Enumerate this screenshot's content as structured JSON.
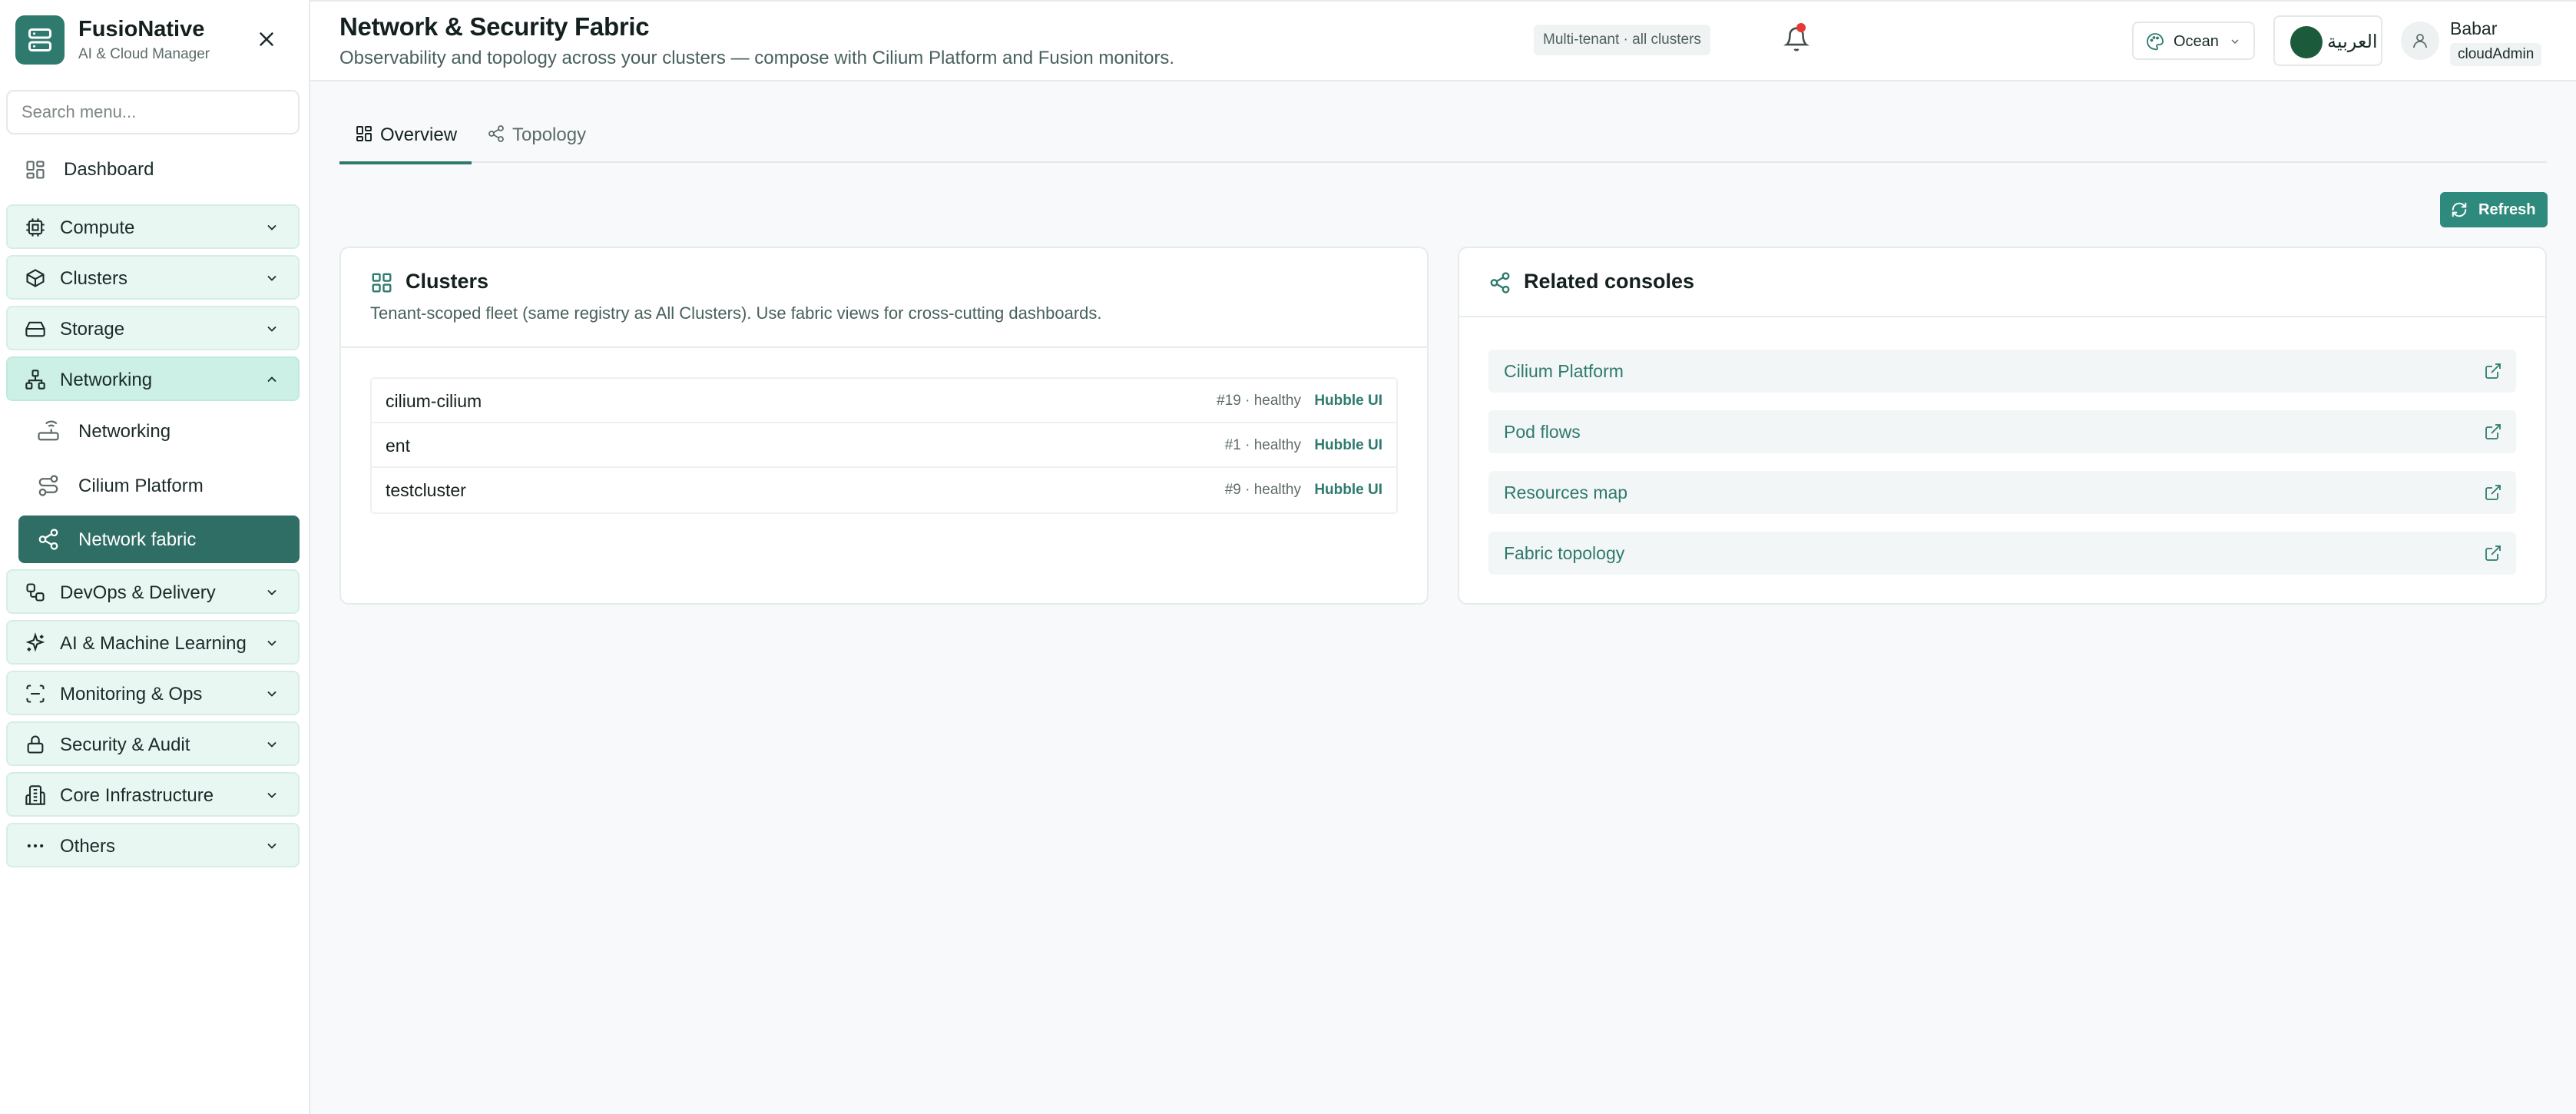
{
  "brand": {
    "name": "FusioNative",
    "subtitle": "AI & Cloud Manager"
  },
  "sidebar": {
    "search_placeholder": "Search menu...",
    "dashboard_label": "Dashboard",
    "groups": [
      {
        "label": "Compute",
        "icon": "cpu-icon",
        "expanded": false
      },
      {
        "label": "Clusters",
        "icon": "box-icon",
        "expanded": false
      },
      {
        "label": "Storage",
        "icon": "hard-drive-icon",
        "expanded": false
      },
      {
        "label": "Networking",
        "icon": "network-icon",
        "expanded": true
      },
      {
        "label": "DevOps & Delivery",
        "icon": "workflow-icon",
        "expanded": false
      },
      {
        "label": "AI & Machine Learning",
        "icon": "sparkles-icon",
        "expanded": false
      },
      {
        "label": "Monitoring & Ops",
        "icon": "scan-icon",
        "expanded": false
      },
      {
        "label": "Security & Audit",
        "icon": "lock-icon",
        "expanded": false
      },
      {
        "label": "Core Infrastructure",
        "icon": "building-icon",
        "expanded": false
      },
      {
        "label": "Others",
        "icon": "ellipsis-icon",
        "expanded": false
      }
    ],
    "networking_items": [
      {
        "label": "Networking",
        "icon": "router-icon",
        "active": false
      },
      {
        "label": "Cilium Platform",
        "icon": "route-icon",
        "active": false
      },
      {
        "label": "Network fabric",
        "icon": "share-icon",
        "active": true
      }
    ]
  },
  "header": {
    "title": "Network & Security Fabric",
    "subtitle": "Observability and topology across your clusters — compose with Cilium Platform and Fusion monitors.",
    "tenant_badge": "Multi-tenant · all clusters",
    "theme": "Ocean",
    "language": "العربية",
    "user_name": "Babar",
    "user_role": "cloudAdmin"
  },
  "tabs": [
    {
      "label": "Overview",
      "active": true
    },
    {
      "label": "Topology",
      "active": false
    }
  ],
  "refresh_label": "Refresh",
  "clusters_card": {
    "title": "Clusters",
    "description": "Tenant-scoped fleet (same registry as All Clusters). Use fabric views for cross-cutting dashboards.",
    "rows": [
      {
        "name": "cilium-cilium",
        "meta": "#19 · healthy",
        "link": "Hubble UI"
      },
      {
        "name": "ent",
        "meta": "#1 · healthy",
        "link": "Hubble UI"
      },
      {
        "name": "testcluster",
        "meta": "#9 · healthy",
        "link": "Hubble UI"
      }
    ]
  },
  "consoles_card": {
    "title": "Related consoles",
    "items": [
      "Cilium Platform",
      "Pod flows",
      "Resources map",
      "Fabric topology"
    ]
  },
  "colors": {
    "accent": "#2e7a6e",
    "active_nav": "#2f6e64",
    "group_bg": "#e9f7f3",
    "notification_dot": "#e53935"
  }
}
